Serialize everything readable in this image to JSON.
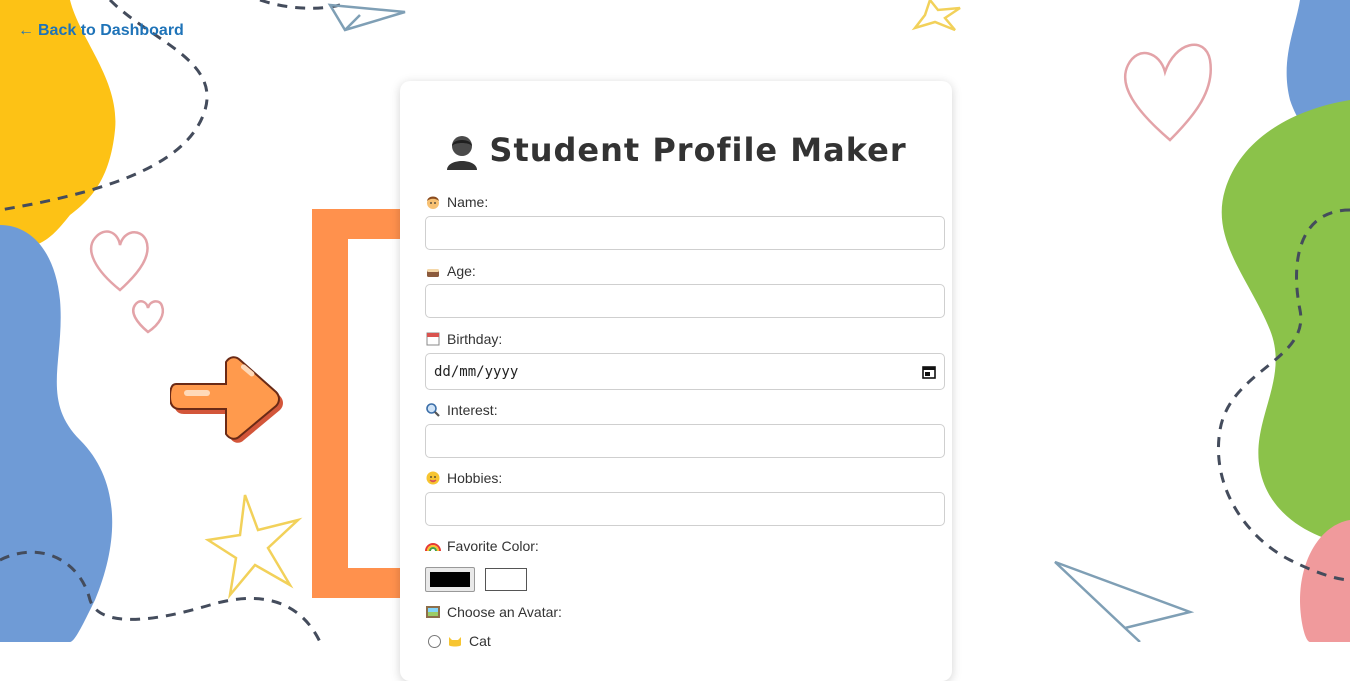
{
  "nav": {
    "back_label": "Back to Dashboard"
  },
  "card": {
    "title": "Student Profile Maker",
    "title_icon": "student-bust-icon"
  },
  "fields": {
    "name": {
      "label": "Name:",
      "icon": "child-face-icon",
      "value": ""
    },
    "age": {
      "label": "Age:",
      "icon": "birthday-cake-icon",
      "value": ""
    },
    "birthday": {
      "label": "Birthday:",
      "icon": "calendar-icon",
      "value": "dd/mm/yyyy"
    },
    "interest": {
      "label": "Interest:",
      "icon": "magnifier-icon",
      "value": ""
    },
    "hobbies": {
      "label": "Hobbies:",
      "icon": "smiley-face-icon",
      "value": ""
    },
    "favorite_color": {
      "label": "Favorite Color:",
      "icon": "rainbow-icon",
      "value": "#000000"
    },
    "avatar": {
      "label": "Choose an Avatar:",
      "icon": "framed-picture-icon",
      "first_option": "Cat"
    }
  },
  "colors": {
    "accent_orange": "#ff914d",
    "link_blue": "#1e73b8",
    "blob_yellow": "#fdc215",
    "blob_blue": "#6f9bd6",
    "blob_green": "#8bc24a",
    "blob_pink": "#f09a9c"
  }
}
